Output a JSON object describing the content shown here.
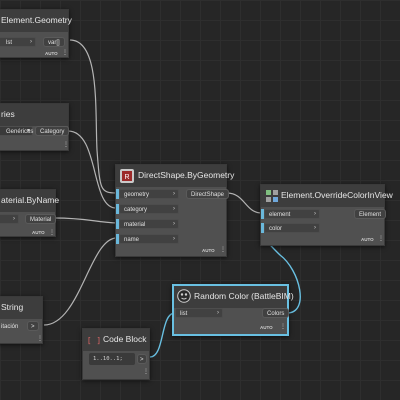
{
  "nodes": {
    "element_geometry": {
      "title": "Element.Geometry",
      "inputs": [
        "lst"
      ],
      "outputs": [
        "var[]"
      ],
      "lacing": "AUTO"
    },
    "categories": {
      "title": "ries",
      "value": "Genéricos",
      "outputs": [
        "Category"
      ]
    },
    "material_byname": {
      "title": "aterial.ByName",
      "outputs": [
        "Material"
      ],
      "lacing": "AUTO"
    },
    "string": {
      "title": "String",
      "value": "itación",
      "outputs": [
        ">"
      ]
    },
    "directshape": {
      "title": "DirectShape.ByGeometry",
      "inputs": [
        "geometry",
        "category",
        "material",
        "name"
      ],
      "outputs": [
        "DirectShape"
      ],
      "lacing": "AUTO"
    },
    "override_color": {
      "title": "Element.OverrideColorInView",
      "inputs": [
        "element",
        "color"
      ],
      "outputs": [
        "Element"
      ],
      "lacing": "AUTO"
    },
    "random_color": {
      "title": "Random Color (BattleBIM)",
      "inputs": [
        "list"
      ],
      "outputs": [
        "Colors"
      ],
      "lacing": "AUTO"
    },
    "code_block": {
      "title": "Code Block",
      "code": "1..10..1;",
      "outputs": [
        ">"
      ]
    }
  },
  "colors": {
    "background": "#262626",
    "node_body": "#505050",
    "node_header": "#3d3d3d",
    "selection": "#69c0e2",
    "wire": "#b4b4b4",
    "port_marker": "#6ab8db"
  },
  "icons": [
    "revit-node-icon",
    "override-color-icon",
    "random-color-icon",
    "code-block-icon"
  ]
}
